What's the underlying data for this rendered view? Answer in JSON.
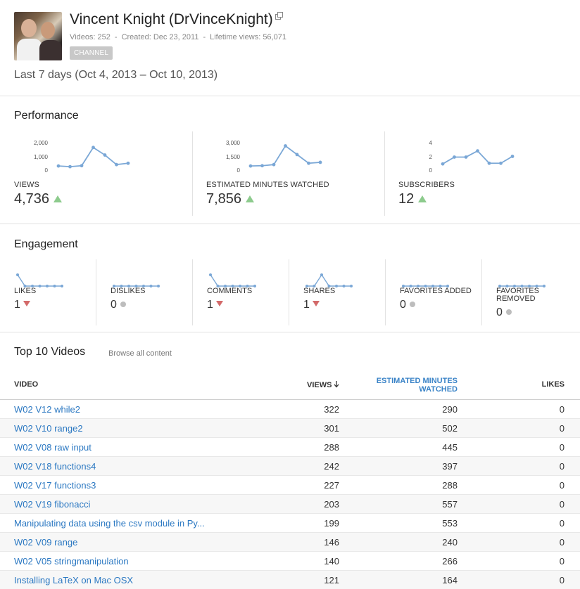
{
  "channel": {
    "title": "Vincent Knight (DrVinceKnight)",
    "videos": "Videos: 252",
    "created": "Created: Dec 23, 2011",
    "lifetime_views": "Lifetime views: 56,071",
    "channel_button": "CHANNEL",
    "external_icon": "external-link-icon",
    "date_range": "Last 7 days (Oct 4, 2013 – Oct 10, 2013)"
  },
  "performance": {
    "title": "Performance",
    "metrics": [
      {
        "label": "VIEWS",
        "value": "4,736",
        "trend": "up",
        "ticks": [
          "2,000",
          "1,000",
          "0"
        ],
        "ymax": 2000,
        "points": [
          300,
          250,
          320,
          1650,
          1100,
          400,
          500
        ]
      },
      {
        "label": "ESTIMATED MINUTES WATCHED",
        "value": "7,856",
        "trend": "up",
        "ticks": [
          "3,000",
          "1,500",
          "0"
        ],
        "ymax": 3000,
        "points": [
          450,
          480,
          600,
          2650,
          1700,
          750,
          850
        ]
      },
      {
        "label": "SUBSCRIBERS",
        "value": "12",
        "trend": "up",
        "ticks": [
          "4",
          "2",
          "0"
        ],
        "ymax": 4,
        "points": [
          0.9,
          1.9,
          1.9,
          2.8,
          1.0,
          1.0,
          2.0
        ]
      }
    ]
  },
  "engagement": {
    "title": "Engagement",
    "metrics": [
      {
        "label": "LIKES",
        "value": "1",
        "trend": "down",
        "points": [
          1,
          0,
          0,
          0,
          0,
          0,
          0
        ]
      },
      {
        "label": "DISLIKES",
        "value": "0",
        "trend": "neutral",
        "points": [
          0,
          0,
          0,
          0,
          0,
          0,
          0
        ]
      },
      {
        "label": "COMMENTS",
        "value": "1",
        "trend": "down",
        "points": [
          1,
          0,
          0,
          0,
          0,
          0,
          0
        ]
      },
      {
        "label": "SHARES",
        "value": "1",
        "trend": "down",
        "points": [
          0,
          0,
          1,
          0,
          0,
          0,
          0
        ]
      },
      {
        "label": "FAVORITES ADDED",
        "value": "0",
        "trend": "neutral",
        "points": [
          0,
          0,
          0,
          0,
          0,
          0,
          0
        ]
      },
      {
        "label": "FAVORITES REMOVED",
        "value": "0",
        "trend": "neutral",
        "points": [
          0,
          0,
          0,
          0,
          0,
          0,
          0
        ]
      }
    ]
  },
  "top_videos": {
    "title": "Top 10 Videos",
    "browse_link": "Browse all content",
    "columns": {
      "video": "VIDEO",
      "views": "VIEWS",
      "minutes_1": "ESTIMATED MINUTES",
      "minutes_2": "WATCHED",
      "likes": "LIKES"
    },
    "rows": [
      {
        "title": "W02 V12 while2",
        "views": "322",
        "minutes": "290",
        "likes": "0"
      },
      {
        "title": "W02 V10 range2",
        "views": "301",
        "minutes": "502",
        "likes": "0"
      },
      {
        "title": "W02 V08 raw input",
        "views": "288",
        "minutes": "445",
        "likes": "0"
      },
      {
        "title": "W02 V18 functions4",
        "views": "242",
        "minutes": "397",
        "likes": "0"
      },
      {
        "title": "W02 V17 functions3",
        "views": "227",
        "minutes": "288",
        "likes": "0"
      },
      {
        "title": "W02 V19 fibonacci",
        "views": "203",
        "minutes": "557",
        "likes": "0"
      },
      {
        "title": "Manipulating data using the csv module in Py...",
        "views": "199",
        "minutes": "553",
        "likes": "0"
      },
      {
        "title": "W02 V09 range",
        "views": "146",
        "minutes": "240",
        "likes": "0"
      },
      {
        "title": "W02 V05 stringmanipulation",
        "views": "140",
        "minutes": "266",
        "likes": "0"
      },
      {
        "title": "Installing LaTeX on Mac OSX",
        "views": "121",
        "minutes": "164",
        "likes": "0"
      }
    ]
  },
  "colors": {
    "line": "#7aa7d6",
    "up": "#8dcb8d",
    "down": "#d36a6a",
    "link": "#2b78c2"
  }
}
